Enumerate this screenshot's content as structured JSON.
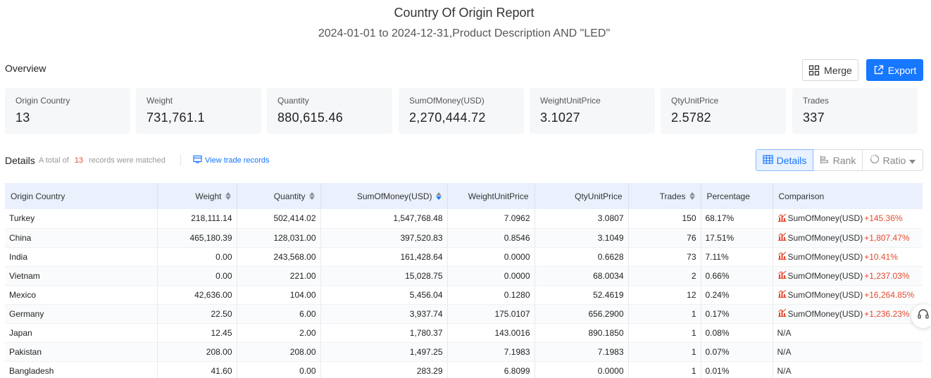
{
  "report": {
    "title": "Country Of Origin Report",
    "subtitle": "2024-01-01 to 2024-12-31,Product Description AND \"LED\""
  },
  "overview": {
    "label": "Overview",
    "merge_label": "Merge",
    "export_label": "Export",
    "stats": [
      {
        "label": "Origin Country",
        "value": "13"
      },
      {
        "label": "Weight",
        "value": "731,761.1"
      },
      {
        "label": "Quantity",
        "value": "880,615.46"
      },
      {
        "label": "SumOfMoney(USD)",
        "value": "2,270,444.72"
      },
      {
        "label": "WeightUnitPrice",
        "value": "3.1027"
      },
      {
        "label": "QtyUnitPrice",
        "value": "2.5782"
      },
      {
        "label": "Trades",
        "value": "337"
      }
    ]
  },
  "details": {
    "label": "Details",
    "meta_prefix": "A total of",
    "count": "13",
    "meta_suffix": "records were matched",
    "view_link": "View trade records",
    "views": {
      "details": "Details",
      "rank": "Rank",
      "ratio": "Ratio"
    }
  },
  "table": {
    "columns": [
      "Origin Country",
      "Weight",
      "Quantity",
      "SumOfMoney(USD)",
      "WeightUnitPrice",
      "QtyUnitPrice",
      "Trades",
      "Percentage",
      "Comparison"
    ],
    "rows": [
      {
        "country": "Turkey",
        "weight": "218,111.14",
        "quantity": "502,414.02",
        "sum": "1,547,768.48",
        "wup": "7.0962",
        "qup": "3.0807",
        "trades": "150",
        "pct": "68.17%",
        "cmp_name": "SumOfMoney(USD)",
        "cmp_val": "+145.36%"
      },
      {
        "country": "China",
        "weight": "465,180.39",
        "quantity": "128,031.00",
        "sum": "397,520.83",
        "wup": "0.8546",
        "qup": "3.1049",
        "trades": "76",
        "pct": "17.51%",
        "cmp_name": "SumOfMoney(USD)",
        "cmp_val": "+1,807.47%"
      },
      {
        "country": "India",
        "weight": "0.00",
        "quantity": "243,568.00",
        "sum": "161,428.64",
        "wup": "0.0000",
        "qup": "0.6628",
        "trades": "73",
        "pct": "7.11%",
        "cmp_name": "SumOfMoney(USD)",
        "cmp_val": "+10.41%"
      },
      {
        "country": "Vietnam",
        "weight": "0.00",
        "quantity": "221.00",
        "sum": "15,028.75",
        "wup": "0.0000",
        "qup": "68.0034",
        "trades": "2",
        "pct": "0.66%",
        "cmp_name": "SumOfMoney(USD)",
        "cmp_val": "+1,237.03%"
      },
      {
        "country": "Mexico",
        "weight": "42,636.00",
        "quantity": "104.00",
        "sum": "5,456.04",
        "wup": "0.1280",
        "qup": "52.4619",
        "trades": "12",
        "pct": "0.24%",
        "cmp_name": "SumOfMoney(USD)",
        "cmp_val": "+16,264.85%"
      },
      {
        "country": "Germany",
        "weight": "22.50",
        "quantity": "6.00",
        "sum": "3,937.74",
        "wup": "175.0107",
        "qup": "656.2900",
        "trades": "1",
        "pct": "0.17%",
        "cmp_name": "SumOfMoney(USD)",
        "cmp_val": "+1,236.23%"
      },
      {
        "country": "Japan",
        "weight": "12.45",
        "quantity": "2.00",
        "sum": "1,780.37",
        "wup": "143.0016",
        "qup": "890.1850",
        "trades": "1",
        "pct": "0.08%",
        "cmp_name": "",
        "cmp_val": "",
        "cmp_na": "N/A"
      },
      {
        "country": "Pakistan",
        "weight": "208.00",
        "quantity": "208.00",
        "sum": "1,497.25",
        "wup": "7.1983",
        "qup": "7.1983",
        "trades": "1",
        "pct": "0.07%",
        "cmp_name": "",
        "cmp_val": "",
        "cmp_na": "N/A"
      },
      {
        "country": "Bangladesh",
        "weight": "41.60",
        "quantity": "0.00",
        "sum": "283.29",
        "wup": "6.8099",
        "qup": "0.0000",
        "trades": "1",
        "pct": "0.01%",
        "cmp_name": "",
        "cmp_val": "",
        "cmp_na": "N/A"
      }
    ]
  },
  "colors": {
    "accent": "#1677ff",
    "increase": "#e6492d",
    "header_bg": "#eaf1fd",
    "card_bg": "#f6f7f9"
  }
}
